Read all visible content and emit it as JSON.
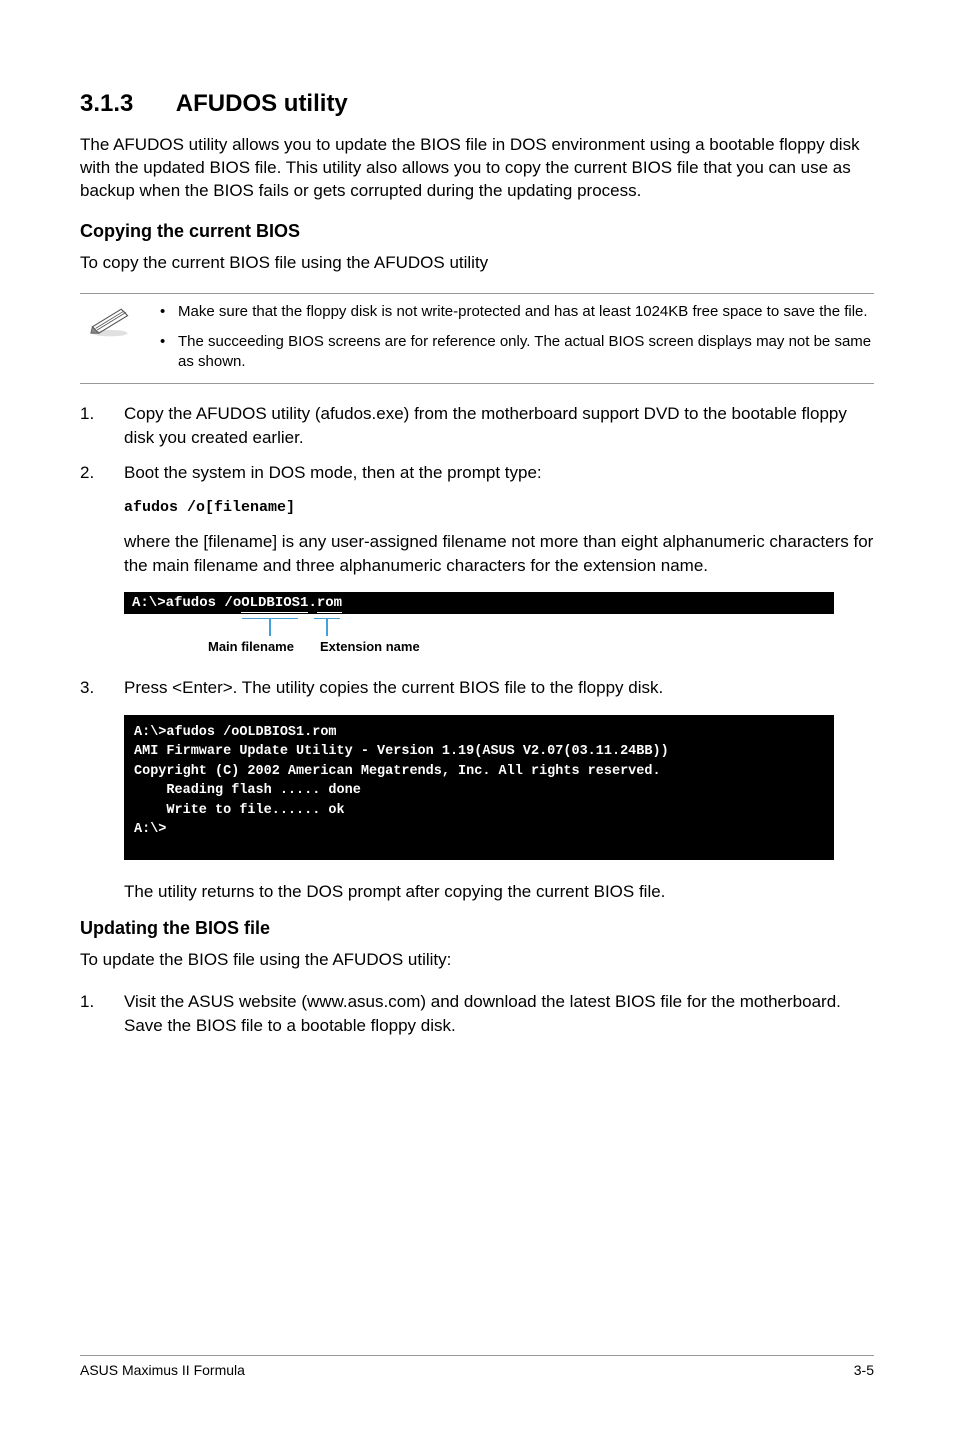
{
  "section": {
    "number": "3.1.3",
    "title": "AFUDOS utility"
  },
  "intro": "The AFUDOS utility allows you to update the BIOS file in DOS environment using a bootable floppy disk with the updated BIOS file. This utility also allows you to copy the current BIOS file that you can use as backup when the BIOS fails or gets corrupted during the updating process.",
  "copy": {
    "heading": "Copying the current BIOS",
    "lead": "To copy the current BIOS file using the AFUDOS utility",
    "notes": [
      "Make sure that the floppy disk is not write-protected and has at least 1024KB free space to save the file.",
      "The succeeding BIOS screens are for reference only. The actual BIOS screen displays may not be same as shown."
    ],
    "steps": {
      "s1": {
        "num": "1.",
        "text": "Copy the AFUDOS utility (afudos.exe) from the motherboard support DVD to the bootable floppy disk you created earlier."
      },
      "s2": {
        "num": "2.",
        "text": "Boot the system in DOS mode, then at the prompt type:"
      }
    },
    "command": "afudos /o[filename]",
    "command_desc": "where the [filename] is any user-assigned filename not more than eight alphanumeric characters  for the main filename and three alphanumeric characters for the extension name.",
    "strip_prompt": "A:\\>afudos /o",
    "strip_main": "OLDBIOS1",
    "strip_dot": ".",
    "strip_ext": "rom",
    "annot_main": "Main filename",
    "annot_ext": "Extension name",
    "s3": {
      "num": "3.",
      "text": "Press <Enter>. The utility copies the current BIOS file to the floppy disk."
    },
    "terminal": "A:\\>afudos /oOLDBIOS1.rom\nAMI Firmware Update Utility - Version 1.19(ASUS V2.07(03.11.24BB))\nCopyright (C) 2002 American Megatrends, Inc. All rights reserved.\n    Reading flash ..... done\n    Write to file...... ok\nA:\\>",
    "after_terminal": "The utility returns to the DOS prompt after copying the current BIOS file."
  },
  "update": {
    "heading": "Updating the BIOS file",
    "lead": "To update the BIOS file using the AFUDOS utility:",
    "s1": {
      "num": "1.",
      "text": "Visit the ASUS website (www.asus.com) and download the latest BIOS file for the motherboard. Save the BIOS file to a bootable floppy disk."
    }
  },
  "footer": {
    "left": "ASUS Maximus II Formula",
    "right": "3-5"
  }
}
